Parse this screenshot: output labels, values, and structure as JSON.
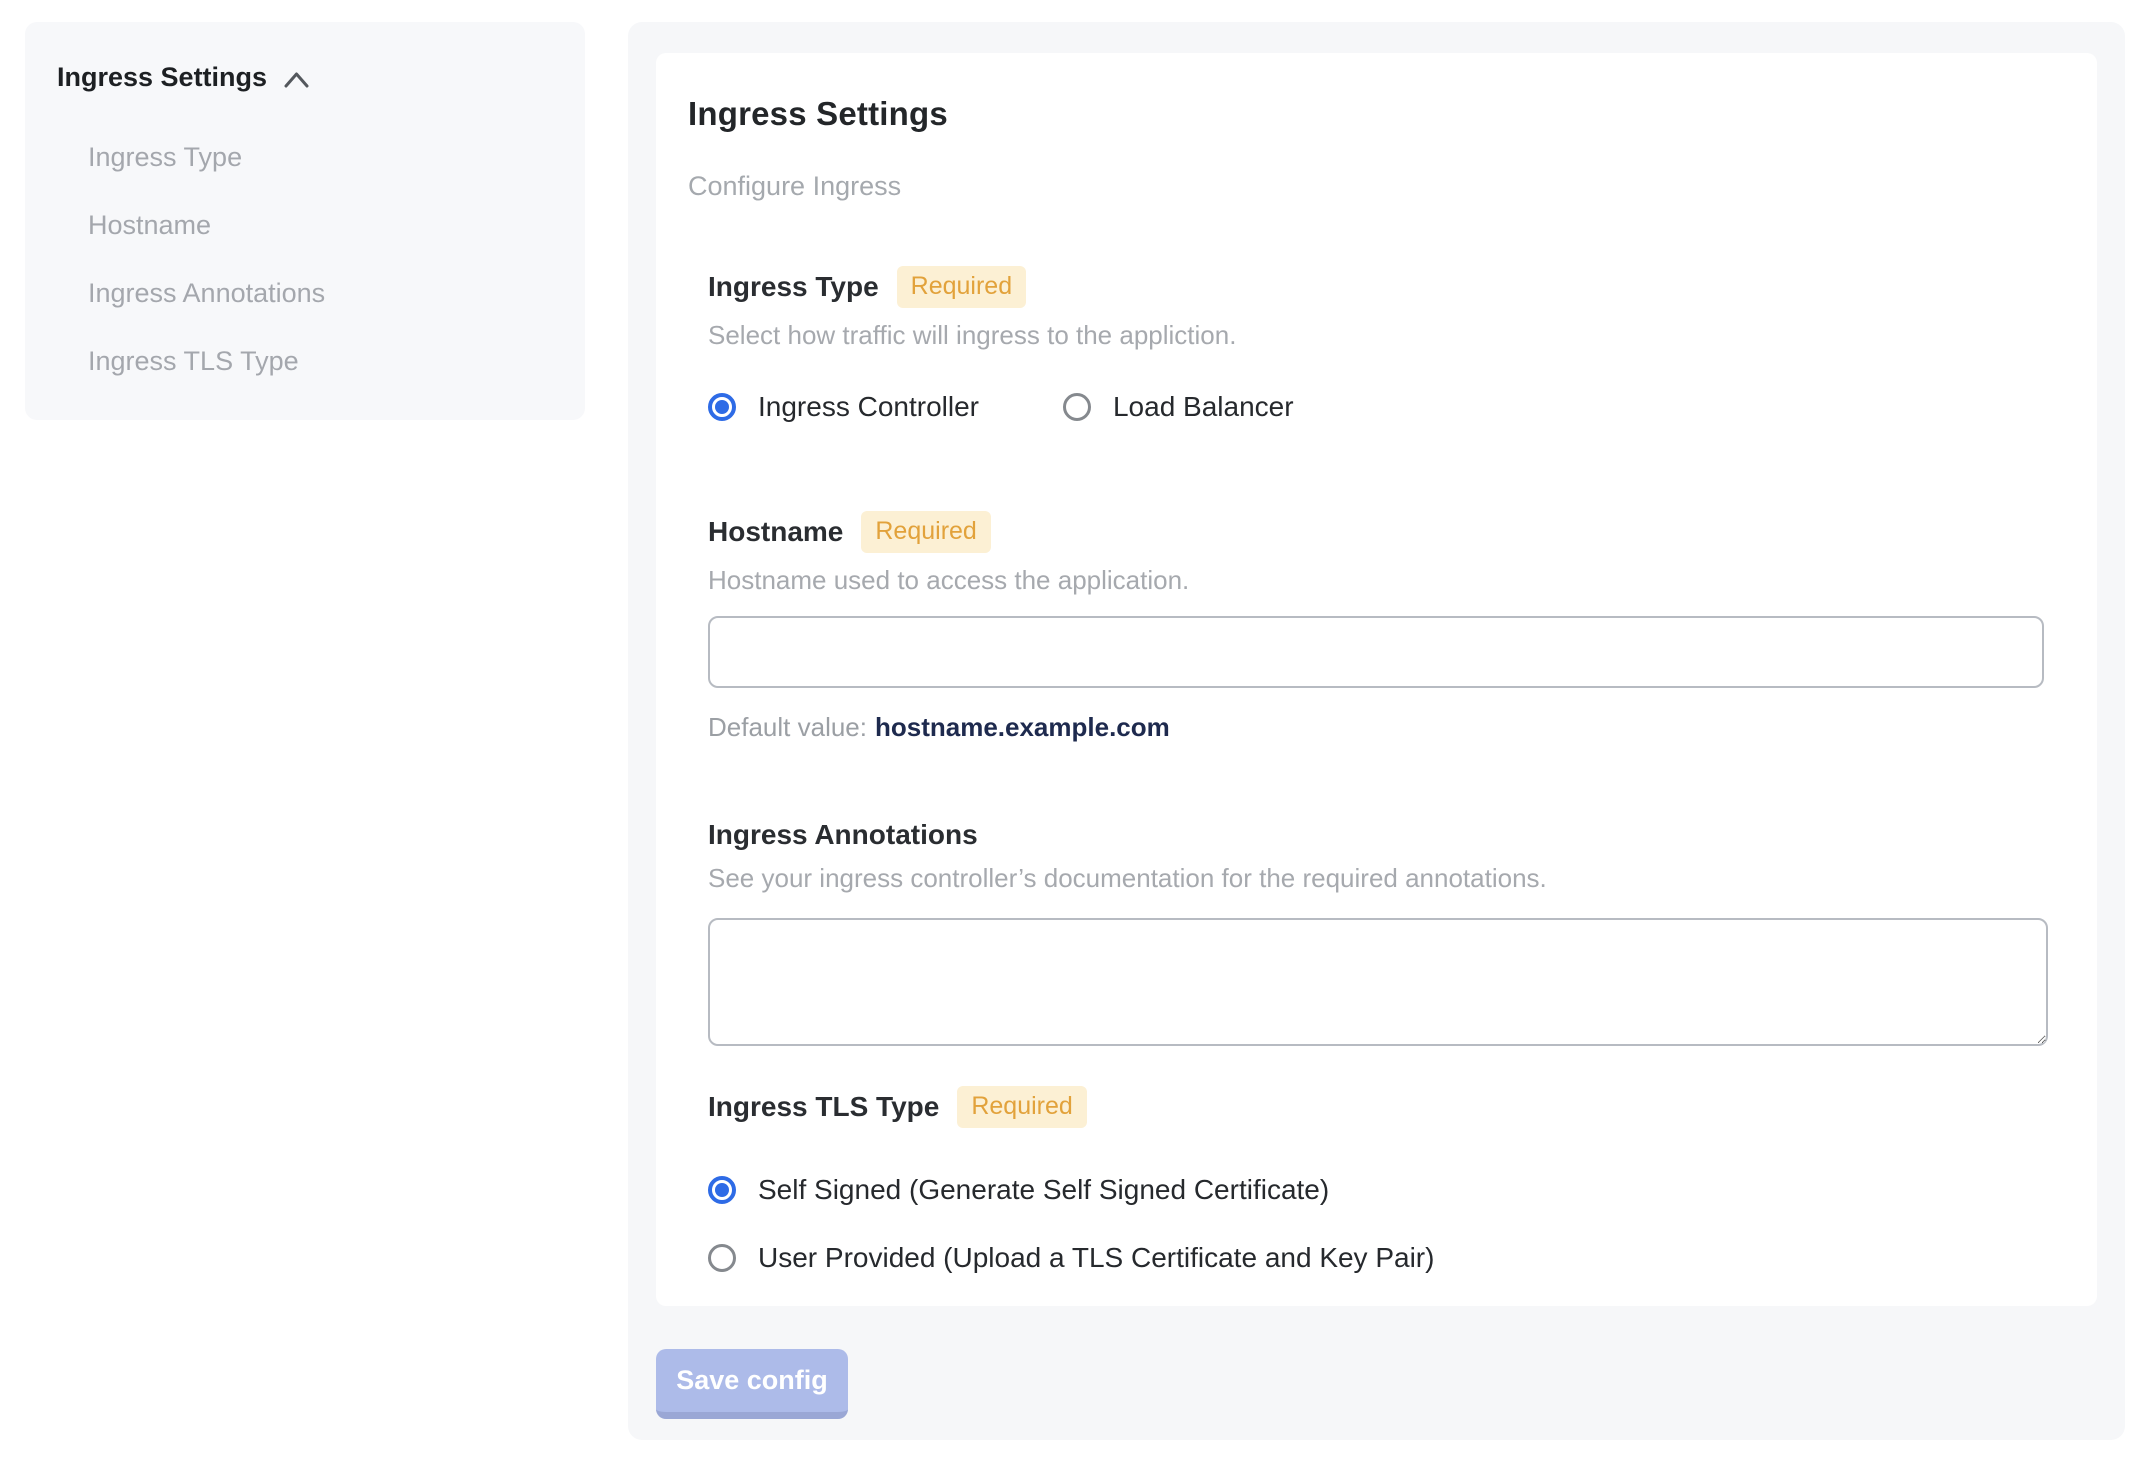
{
  "sidebar": {
    "header": "Ingress Settings",
    "items": [
      {
        "label": "Ingress Type"
      },
      {
        "label": "Hostname"
      },
      {
        "label": "Ingress Annotations"
      },
      {
        "label": "Ingress TLS Type"
      }
    ]
  },
  "panel": {
    "title": "Ingress Settings",
    "subtitle": "Configure Ingress",
    "required_label": "Required",
    "sections": {
      "ingress_type": {
        "label": "Ingress Type",
        "description": "Select how traffic will ingress to the appliction.",
        "options": [
          {
            "label": "Ingress Controller",
            "selected": true
          },
          {
            "label": "Load Balancer",
            "selected": false
          }
        ]
      },
      "hostname": {
        "label": "Hostname",
        "description": "Hostname used to access the application.",
        "value": "",
        "default_prefix": "Default value:",
        "default_value": "hostname.example.com"
      },
      "annotations": {
        "label": "Ingress Annotations",
        "description": "See your ingress controller’s documentation for the required annotations.",
        "value": ""
      },
      "tls": {
        "label": "Ingress TLS Type",
        "options": [
          {
            "label": "Self Signed (Generate Self Signed Certificate)",
            "selected": true
          },
          {
            "label": "User Provided (Upload a TLS Certificate and Key Pair)",
            "selected": false
          }
        ]
      }
    },
    "save_button": "Save config"
  },
  "colors": {
    "accent_blue": "#2e6be6",
    "required_badge_bg": "#fcf0d4",
    "required_badge_text": "#e2a23b",
    "save_button_bg": "#adbbe9",
    "save_button_edge": "#9aa7d5",
    "panel_bg": "#f6f7f9",
    "default_value_text": "#1e2a4e"
  }
}
